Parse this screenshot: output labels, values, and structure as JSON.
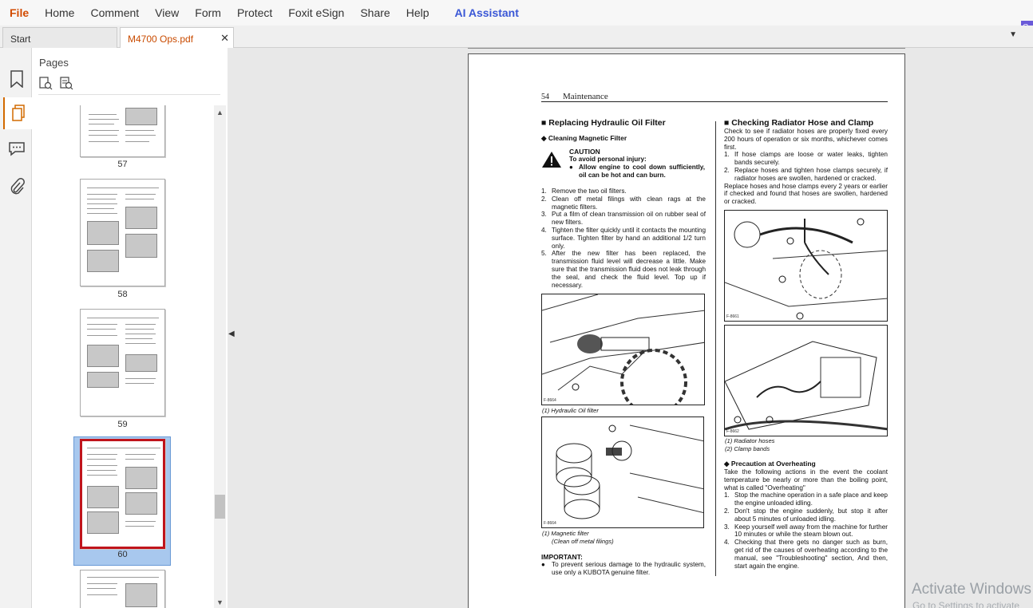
{
  "menu": {
    "items": [
      "File",
      "Home",
      "Comment",
      "View",
      "Form",
      "Protect",
      "Foxit eSign",
      "Share",
      "Help"
    ],
    "ai_assistant": "AI Assistant",
    "corner_text": "C in"
  },
  "tabs": {
    "start": "Start",
    "document": "M4700 Ops.pdf"
  },
  "panel": {
    "title": "Pages",
    "thumb_labels": [
      "57",
      "58",
      "59",
      "60"
    ]
  },
  "pdf_page": {
    "page_number": "54",
    "section": "Maintenance",
    "left": {
      "heading": "Replacing Hydraulic Oil Filter",
      "subheading": "Cleaning Magnetic Filter",
      "caution_title": "CAUTION",
      "caution_intro": "To avoid personal injury:",
      "caution_bullet": "Allow engine to cool down sufficiently, oil can be hot and can burn.",
      "steps": [
        "Remove the two oil filters.",
        "Clean off metal filings with clean rags at the magnetic filters.",
        "Put a film of clean transmission oil on rubber seal of new filters.",
        "Tighten the filter quickly until it contacts the mounting surface. Tighten filter by hand an additional 1/2 turn only.",
        "After the new filter has been replaced, the transmission fluid level will decrease a little. Make sure that the transmission fluid does not leak through the seal, and check the fluid level. Top up if necessary."
      ],
      "fig1_id": "F-8664",
      "fig1_caption": "(1) Hydraulic Oil filter",
      "fig2_id": "F-8664",
      "fig2_caption_1": "(1) Magnetic filter",
      "fig2_caption_2": "(Clean off metal filings)",
      "important_title": "IMPORTANT:",
      "important_text": "To prevent serious damage to the hydraulic system, use only a KUBOTA genuine filter."
    },
    "right": {
      "heading": "Checking Radiator Hose and Clamp",
      "intro": "Check to see if radiator hoses are properly fixed every 200 hours of operation or six months, whichever comes first.",
      "steps": [
        "If hose clamps are loose or water leaks, tighten bands securely.",
        "Replace hoses and tighten hose clamps securely, if radiator hoses are swollen, hardened or cracked."
      ],
      "replace_text": "Replace hoses and hose clamps every 2 years or earlier if checked and found that hoses are swollen, hardened or cracked.",
      "fig3_id": "F-8661",
      "fig4_id": "F-8662",
      "fig_caption_1": "(1) Radiator hoses",
      "fig_caption_2": "(2) Clamp bands",
      "overheat_heading": "Precaution at Overheating",
      "overheat_intro": "Take the following actions in the event the coolant temperature be nearly or more than the boiling point, what is called \"Overheating\"",
      "overheat_steps": [
        "Stop the machine operation in a safe place and keep the engine unloaded idling.",
        "Don't stop the engine suddenly, but stop it after about 5 minutes of unloaded idling.",
        "Keep yourself well away from the machine for further 10 minutes or while the steam blown out.",
        "Checking that there gets no danger such as burn, get rid of the causes of overheating according to the manual, see \"Troubleshooting\" section, And then, start again the engine."
      ]
    }
  },
  "watermark": {
    "line1": "Activate Windows",
    "line2": "Go to Settings to activate"
  },
  "colors": {
    "accent": "#d24a00",
    "ai": "#3a57d6",
    "selection": "#a8c8ee",
    "selected_border": "#c0141c"
  }
}
